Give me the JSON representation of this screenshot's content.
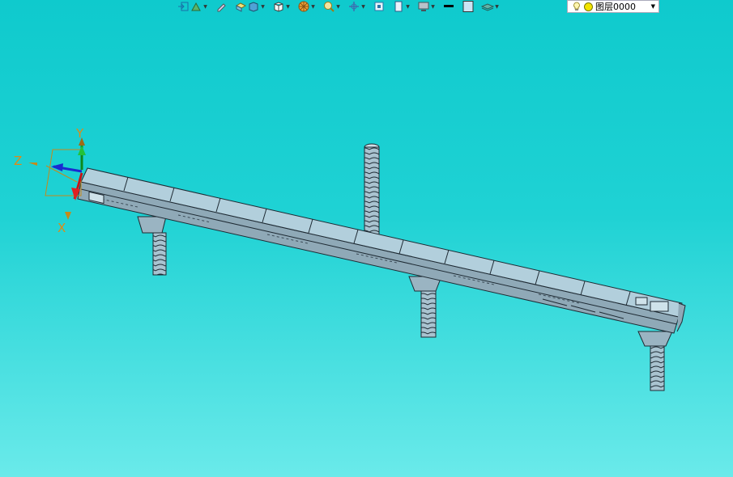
{
  "toolbar": {
    "icons": [
      "view-orient-icon",
      "render-mode-icon",
      "pen-icon",
      "shaded-box-icon",
      "solid-cube-icon",
      "wire-cube-icon",
      "section-wheel-icon",
      "zoom-icon",
      "pan-icon",
      "fit-view-icon",
      "standard-view-icon",
      "display-icon",
      "line-color-icon",
      "fill-color-icon",
      "layer-tool-icon"
    ]
  },
  "layer": {
    "selected": "图层0000",
    "bulb_icon": "lightbulb-icon",
    "color_icon": "yellow-circle-icon"
  },
  "colors": {
    "bg_top": "#0fcacd",
    "bg_bottom": "#6aeaea",
    "model_fill": "#a8c6d4",
    "model_line": "#1e2a33"
  },
  "axes": {
    "x_label": "X",
    "y_label": "Y",
    "z_label": "Z"
  }
}
